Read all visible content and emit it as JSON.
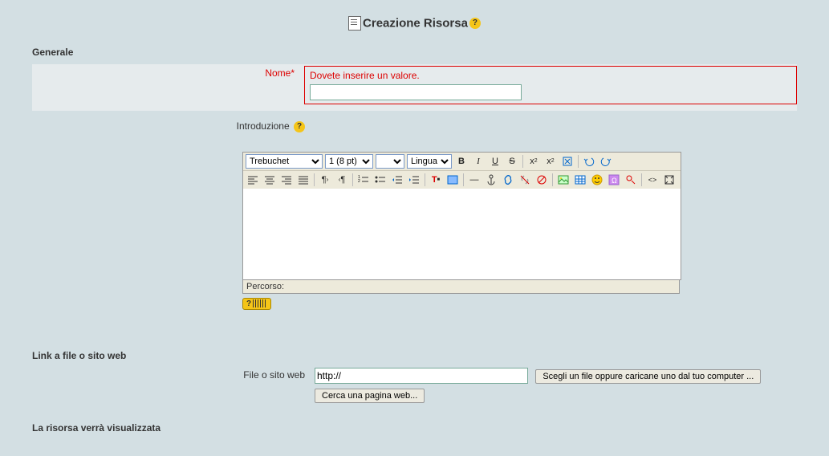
{
  "page": {
    "title": "Creazione Risorsa"
  },
  "sections": {
    "generale": "Generale",
    "link": "Link a file o sito web",
    "display": "La risorsa verrà visualizzata"
  },
  "fields": {
    "nome": {
      "label": "Nome",
      "error": "Dovete inserire un valore.",
      "value": ""
    },
    "introduzione": {
      "label": "Introduzione"
    },
    "file": {
      "label": "File o sito web",
      "value": "http://"
    }
  },
  "editor": {
    "font": "Trebuchet",
    "size": "1 (8 pt)",
    "lang": "Lingua",
    "path_label": "Percorso:"
  },
  "buttons": {
    "choose_file": "Scegli un file oppure caricane uno dal tuo computer ...",
    "search_web": "Cerca una pagina web...",
    "kb_help": "?"
  }
}
